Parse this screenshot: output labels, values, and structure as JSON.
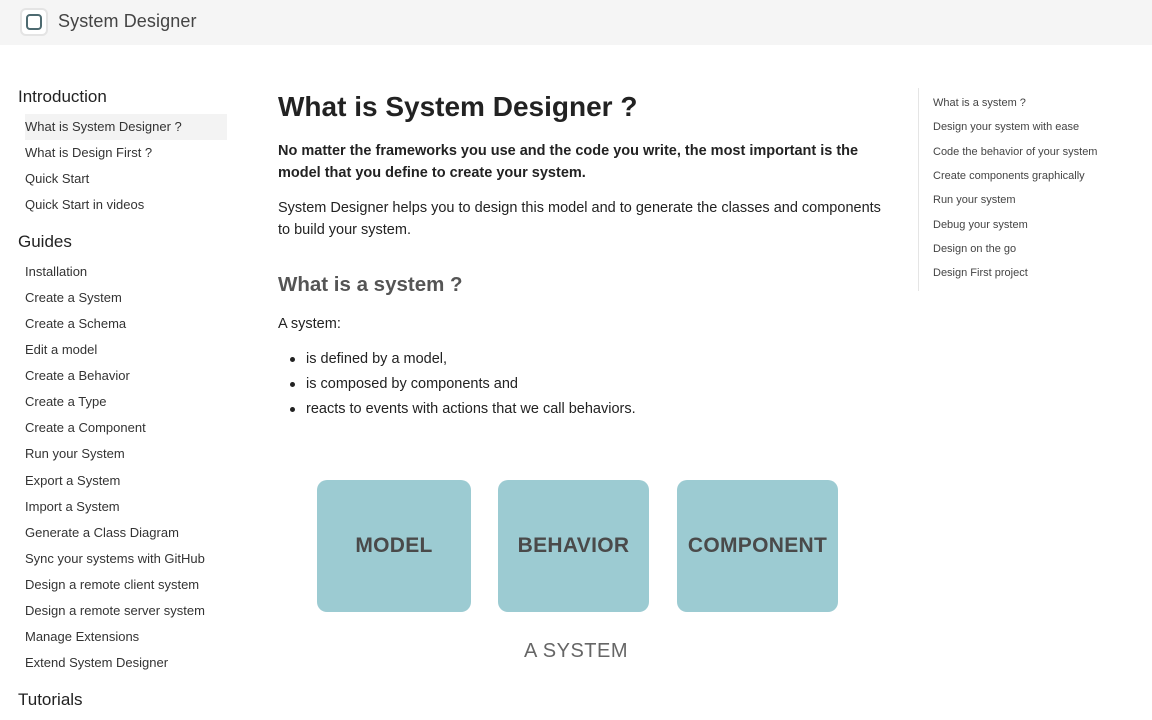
{
  "header": {
    "brand": "System Designer",
    "logo_icon": "square-logo-icon"
  },
  "sidebar": {
    "sections": [
      {
        "title": "Introduction",
        "items": [
          {
            "label": "What is System Designer ?",
            "active": true
          },
          {
            "label": "What is Design First ?"
          },
          {
            "label": "Quick Start"
          },
          {
            "label": "Quick Start in videos"
          }
        ]
      },
      {
        "title": "Guides",
        "items": [
          {
            "label": "Installation"
          },
          {
            "label": "Create a System"
          },
          {
            "label": "Create a Schema"
          },
          {
            "label": "Edit a model"
          },
          {
            "label": "Create a Behavior"
          },
          {
            "label": "Create a Type"
          },
          {
            "label": "Create a Component"
          },
          {
            "label": "Run your System"
          },
          {
            "label": "Export a System"
          },
          {
            "label": "Import a System"
          },
          {
            "label": "Generate a Class Diagram"
          },
          {
            "label": "Sync your systems with GitHub"
          },
          {
            "label": "Design a remote client system"
          },
          {
            "label": "Design a remote server system"
          },
          {
            "label": "Manage Extensions"
          },
          {
            "label": "Extend System Designer"
          }
        ]
      },
      {
        "title": "Tutorials",
        "items": []
      }
    ]
  },
  "main": {
    "title": "What is System Designer ?",
    "lead": "No matter the frameworks you use and the code you write, the most important is the model that you define to create your system.",
    "paragraph": "System Designer helps you to design this model and to generate the classes and components to build your system.",
    "section_title": "What is a system ?",
    "intro": "A system:",
    "bullets": [
      "is defined by a model,",
      "is composed by components and",
      "reacts to events with actions that we call behaviors."
    ],
    "diagram": {
      "boxes": [
        "MODEL",
        "BEHAVIOR",
        "COMPONENT"
      ],
      "caption": "A SYSTEM",
      "box_color": "#9ccbd2"
    }
  },
  "toc": {
    "items": [
      "What is a system ?",
      "Design your system with ease",
      "Code the behavior of your system",
      "Create components graphically",
      "Run your system",
      "Debug your system",
      "Design on the go",
      "Design First project"
    ]
  }
}
